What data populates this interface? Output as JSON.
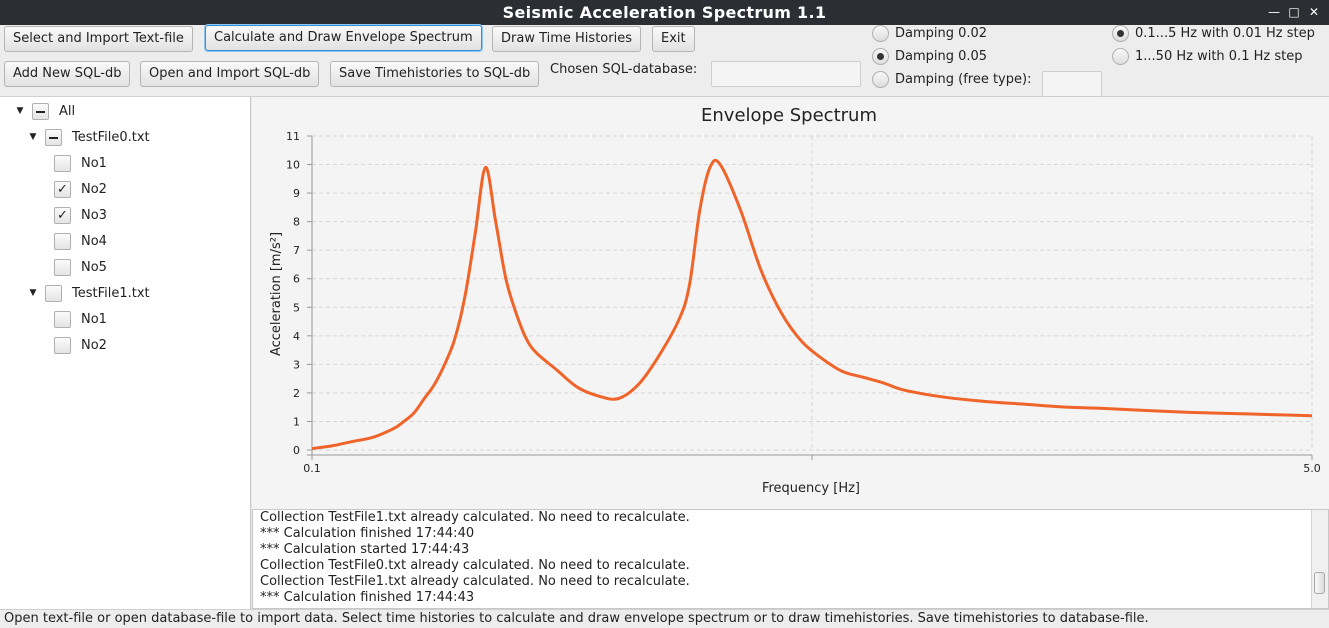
{
  "window": {
    "title": "Seismic Acceleration Spectrum 1.1"
  },
  "toolbar": {
    "select_import_label": "Select and Import Text-file",
    "calc_draw_label": "Calculate and Draw Envelope Spectrum",
    "draw_time_label": "Draw Time Histories",
    "exit_label": "Exit",
    "add_sql_label": "Add New SQL-db",
    "open_sql_label": "Open and Import SQL-db",
    "save_sql_label": "Save Timehistories to SQL-db",
    "chosen_db_label": "Chosen SQL-database:",
    "chosen_db_value": "",
    "damping_options": [
      {
        "label": "Damping 0.02",
        "selected": false
      },
      {
        "label": "Damping 0.05",
        "selected": true
      },
      {
        "label": "Damping (free type):",
        "selected": false
      }
    ],
    "damping_free_value": "",
    "freq_options": [
      {
        "label": "0.1...5 Hz with 0.01 Hz step",
        "selected": true
      },
      {
        "label": "1...50 Hz with 0.1 Hz step",
        "selected": false
      }
    ]
  },
  "tree": {
    "root": {
      "label": "All",
      "state": "partial"
    },
    "files": [
      {
        "label": "TestFile0.txt",
        "state": "partial",
        "items": [
          {
            "label": "No1",
            "checked": false
          },
          {
            "label": "No2",
            "checked": true
          },
          {
            "label": "No3",
            "checked": true
          },
          {
            "label": "No4",
            "checked": false
          },
          {
            "label": "No5",
            "checked": false
          }
        ]
      },
      {
        "label": "TestFile1.txt",
        "state": "unchecked",
        "items": [
          {
            "label": "No1",
            "checked": false
          },
          {
            "label": "No2",
            "checked": false
          }
        ]
      }
    ]
  },
  "chart_data": {
    "type": "line",
    "title": "Envelope Spectrum",
    "xlabel": "Frequency [Hz]",
    "ylabel": "Acceleration [m/s²]",
    "xlim": [
      0.1,
      5.0
    ],
    "ylim": [
      0,
      11
    ],
    "x_tick_labels": [
      "0.1",
      "5.0"
    ],
    "y_ticks": [
      0,
      1,
      2,
      3,
      4,
      5,
      6,
      7,
      8,
      9,
      10,
      11
    ],
    "grid": true,
    "color": "#f0642a",
    "series": [
      {
        "x": [
          0.1,
          0.2,
          0.3,
          0.4,
          0.5,
          0.55,
          0.6,
          0.65,
          0.7,
          0.75,
          0.8,
          0.85,
          0.9,
          0.95,
          1.0,
          1.05,
          1.1,
          1.15,
          1.2,
          1.3,
          1.4,
          1.5,
          1.6,
          1.7,
          1.8,
          1.9,
          1.95,
          2.0,
          2.05,
          2.1,
          2.2,
          2.3,
          2.4,
          2.5,
          2.6,
          2.7,
          2.8,
          2.9,
          3.0,
          3.2,
          3.4,
          3.6,
          3.8,
          4.0,
          4.2,
          4.4,
          4.6,
          4.8,
          5.0
        ],
        "y": [
          0.05,
          0.15,
          0.3,
          0.45,
          0.75,
          1.0,
          1.3,
          1.8,
          2.3,
          3.0,
          3.9,
          5.4,
          7.6,
          9.9,
          8.0,
          6.0,
          4.8,
          3.9,
          3.4,
          2.8,
          2.2,
          1.9,
          1.8,
          2.3,
          3.3,
          4.6,
          5.8,
          8.4,
          9.9,
          10.0,
          8.4,
          6.3,
          4.8,
          3.8,
          3.2,
          2.75,
          2.55,
          2.35,
          2.1,
          1.85,
          1.7,
          1.6,
          1.5,
          1.45,
          1.38,
          1.32,
          1.28,
          1.24,
          1.2
        ]
      }
    ]
  },
  "log": {
    "lines": [
      "Collection TestFile1.txt already calculated.  No need to recalculate.",
      "*** Calculation finished 17:44:40",
      "*** Calculation started 17:44:43",
      "Collection TestFile0.txt already calculated.  No need to recalculate.",
      "Collection TestFile1.txt already calculated.  No need to recalculate.",
      "*** Calculation finished 17:44:43"
    ]
  },
  "status": {
    "text": "Open text-file or open database-file to import data. Select time histories to calculate and draw envelope spectrum or to draw timehistories. Save timehistories to database-file."
  }
}
